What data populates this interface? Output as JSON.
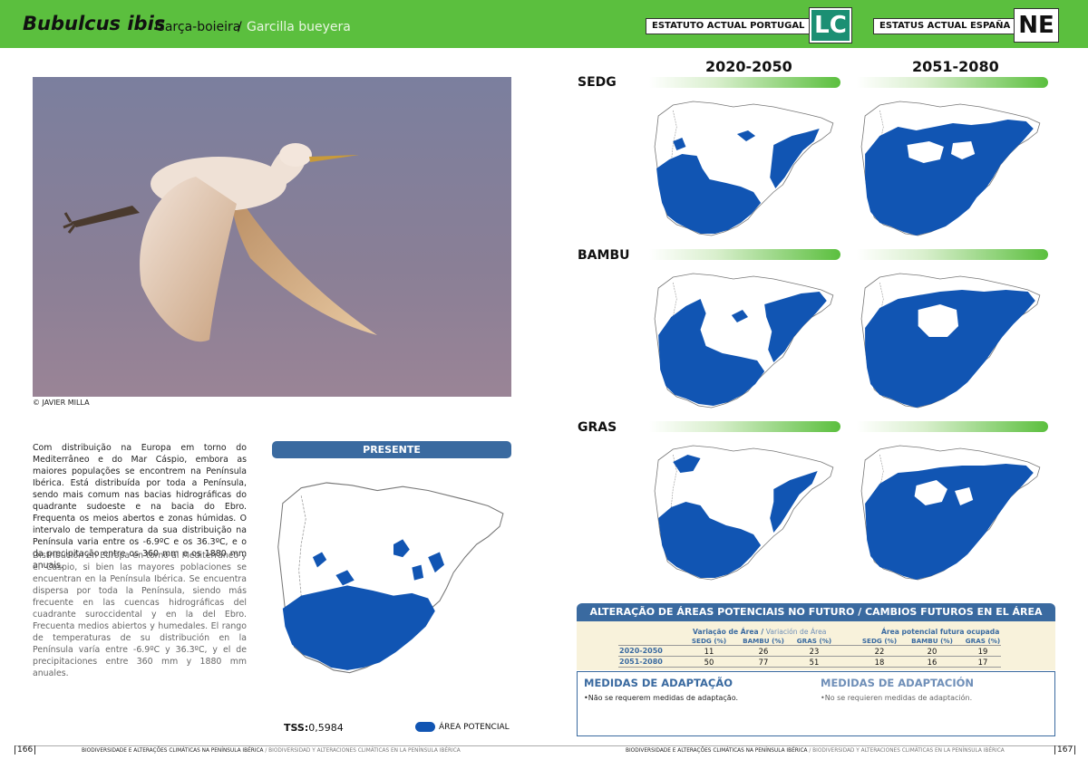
{
  "header": {
    "species_scientific": "Bubulcus ibis",
    "name_pt": "Garça-boieira",
    "separator": "/",
    "name_es": "Garcilla bueyera",
    "status_pt_label": "ESTATUTO ACTUAL PORTUGAL",
    "status_pt_value": "LC",
    "status_es_label": "ESTATUS ACTUAL ESPAÑA",
    "status_es_value": "NE",
    "colors": {
      "band": "#5bbf3e",
      "lc": "#1b8f73"
    }
  },
  "photo": {
    "credit": "© JAVIER MILLA"
  },
  "description": {
    "pt": "Com distribuição na Europa em torno do Mediterrâneo e do Mar Cáspio, embora as maiores populações se encontrem na Península Ibérica. Está distribuída por toda a Península, sendo mais comum nas bacias hidrográficas do quadrante sudoeste e na bacia do Ebro. Frequenta os meios abertos e zonas húmidas. O intervalo de temperatura da sua distribuição na Península varia entre os -6.9ºC e os 36.3ºC, e o da precipitação entre os 360 mm e os 1880 mm anuais.",
    "es": "Distribución en Europa en torno al Mediterráneo y el Caspio, si bien las mayores poblaciones se encuentran en la Península Ibérica. Se encuentra dispersa por toda la Península, siendo más frecuente en las cuencas hidrográficas del cuadrante suroccidental y en la del Ebro. Frecuenta medios abiertos y humedales. El rango de temperaturas de su distribución en la Península varía entre -6.9ºC y 36.3ºC, y el de precipitaciones entre 360 mm y 1880 mm anuales."
  },
  "presente": {
    "label": "PRESENTE",
    "tss_label": "TSS:",
    "tss_value": "0,5984",
    "legend": "ÁREA POTENCIAL",
    "colors": {
      "area": "#1155b3",
      "bar": "#3a6aa0"
    }
  },
  "future_maps": {
    "periods": [
      "2020-2050",
      "2051-2080"
    ],
    "scenarios": [
      "SEDG",
      "BAMBU",
      "GRAS"
    ]
  },
  "alteration": {
    "title": "ALTERAÇÃO DE ÁREAS POTENCIAIS NO FUTURO / CAMBIOS FUTUROS EN EL ÁREA POTENCIAL",
    "group1_pt": "Variação de Área",
    "group1_es": "Variación de Área",
    "group2": "Área potencial futura ocupada",
    "columns": [
      "SEDG (%)",
      "BAMBU (%)",
      "GRAS (%)",
      "SEDG (%)",
      "BAMBU (%)",
      "GRAS (%)"
    ],
    "rows": [
      {
        "label": "2020-2050",
        "values": [
          "11",
          "26",
          "23",
          "22",
          "20",
          "19"
        ]
      },
      {
        "label": "2051-2080",
        "values": [
          "50",
          "77",
          "51",
          "18",
          "16",
          "17"
        ]
      }
    ]
  },
  "medidas": {
    "title_pt": "MEDIDAS DE ADAPTAÇÃO",
    "text_pt": "•Não se requerem medidas de adaptação.",
    "title_es": "MEDIDAS DE ADAPTACIÓN",
    "text_es": "•No se requieren medidas de adaptación."
  },
  "footer": {
    "page_left": "166",
    "page_right": "167",
    "text_pt": "BIODIVERSIDADE E ALTERAÇÕES CLIMÁTICAS NA PENÍNSULA IBÉRICA",
    "text_sep": " / ",
    "text_es": "BIODIVERSIDAD Y ALTERACIONES CLIMÁTICAS EN LA PENÍNSULA IBÉRICA"
  }
}
